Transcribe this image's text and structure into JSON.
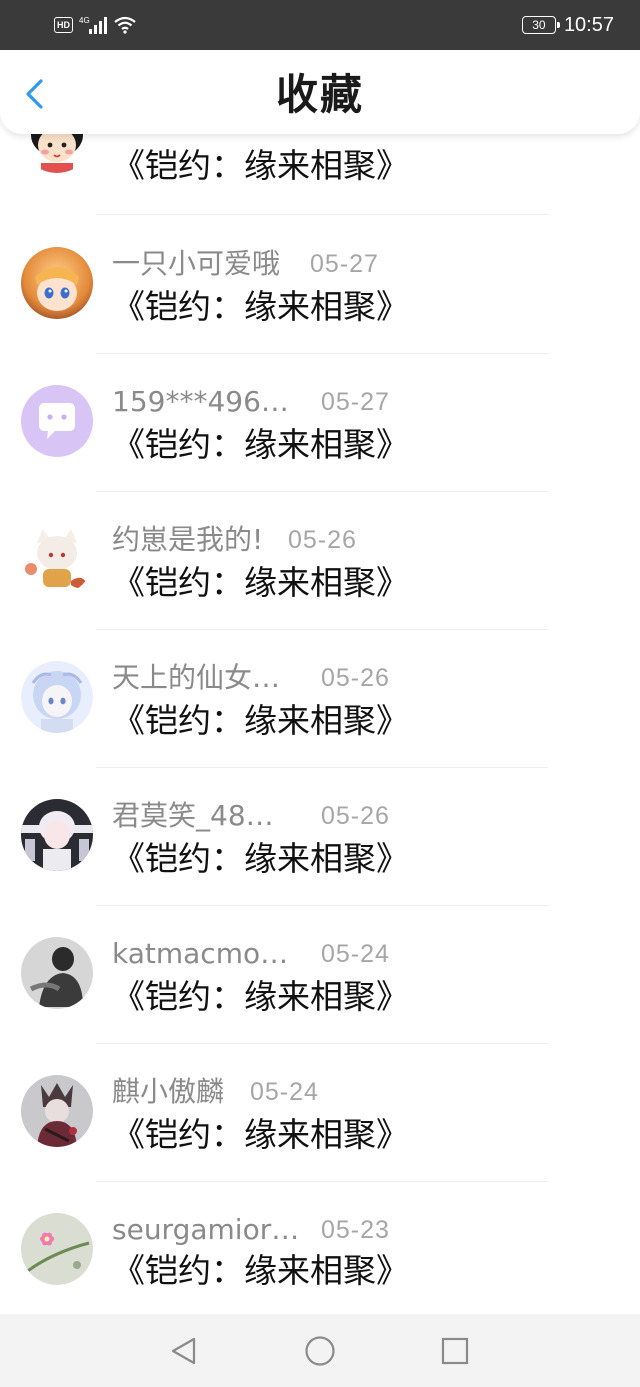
{
  "status_bar": {
    "hd": "HD",
    "network": "4G",
    "battery": "30",
    "time": "10:57",
    "icons": [
      "hd-badge",
      "signal-icon",
      "wifi-icon",
      "battery-icon"
    ]
  },
  "header": {
    "title": "收藏",
    "back_icon": "chevron-left-icon",
    "accent_color": "#2f9bf0"
  },
  "items": [
    {
      "name": "",
      "date": "",
      "title": "《铠约：缘来相聚》",
      "avatar": "cartoon-girl-avatar"
    },
    {
      "name": "一只小可爱哦",
      "date": "05-27",
      "title": "《铠约：缘来相聚》",
      "avatar": "anime-blonde-avatar"
    },
    {
      "name": "159***496…",
      "date": "05-27",
      "title": "《铠约：缘来相聚》",
      "avatar": "default-chat-bubble-avatar"
    },
    {
      "name": "约崽是我的!",
      "date": "05-26",
      "title": "《铠约：缘来相聚》",
      "avatar": "fox-girl-avatar"
    },
    {
      "name": "天上的仙女…",
      "date": "05-26",
      "title": "《铠约：缘来相聚》",
      "avatar": "ice-anime-girl-avatar"
    },
    {
      "name": "君莫笑_48…",
      "date": "05-26",
      "title": "《铠约：缘来相聚》",
      "avatar": "white-hair-boy-avatar"
    },
    {
      "name": "katmacmo…",
      "date": "05-24",
      "title": "《铠约：缘来相聚》",
      "avatar": "monochrome-photo-avatar"
    },
    {
      "name": "麒小傲麟",
      "date": "05-24",
      "title": "《铠约：缘来相聚》",
      "avatar": "dark-warrior-avatar"
    },
    {
      "name": "seurgamior…",
      "date": "05-23",
      "title": "《铠约：缘来相聚》",
      "avatar": "pink-flower-avatar"
    }
  ],
  "nav_bar": {
    "back_icon": "triangle-back-icon",
    "home_icon": "circle-home-icon",
    "recents_icon": "square-recents-icon"
  }
}
